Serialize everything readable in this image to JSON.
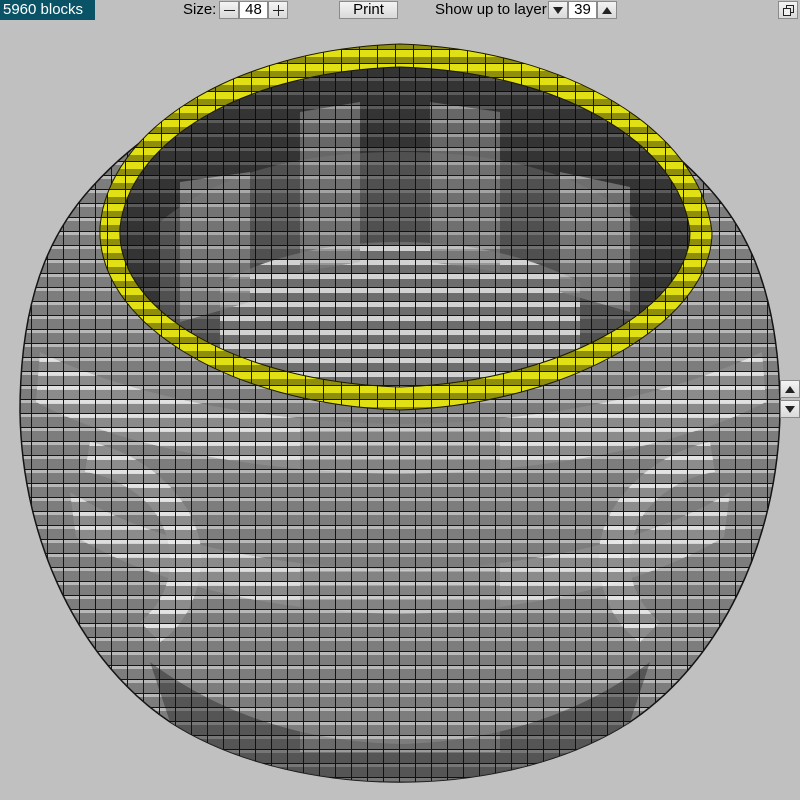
{
  "app": {
    "block_count": "5960 blocks"
  },
  "toolbar": {
    "size_label": "Size:",
    "size_value": "48",
    "decrease_icon": "minus-icon",
    "increase_icon": "plus-icon",
    "print_label": "Print",
    "layer_label": "Show up to layer:",
    "layer_value": "39",
    "layer_down_icon": "triangle-down-icon",
    "layer_up_icon": "triangle-up-icon",
    "window_icon": "restore-window-icon"
  },
  "side_controls": {
    "up_icon": "triangle-up-icon",
    "down_icon": "triangle-down-icon"
  },
  "colors": {
    "background": "#c0c0c0",
    "count_badge": "#0a5366",
    "rim_highlight": "#d6d60e",
    "block_light": "#ededed",
    "block_mid": "#8f8f8f",
    "block_dark": "#505050",
    "grid_lines": "#151515"
  }
}
